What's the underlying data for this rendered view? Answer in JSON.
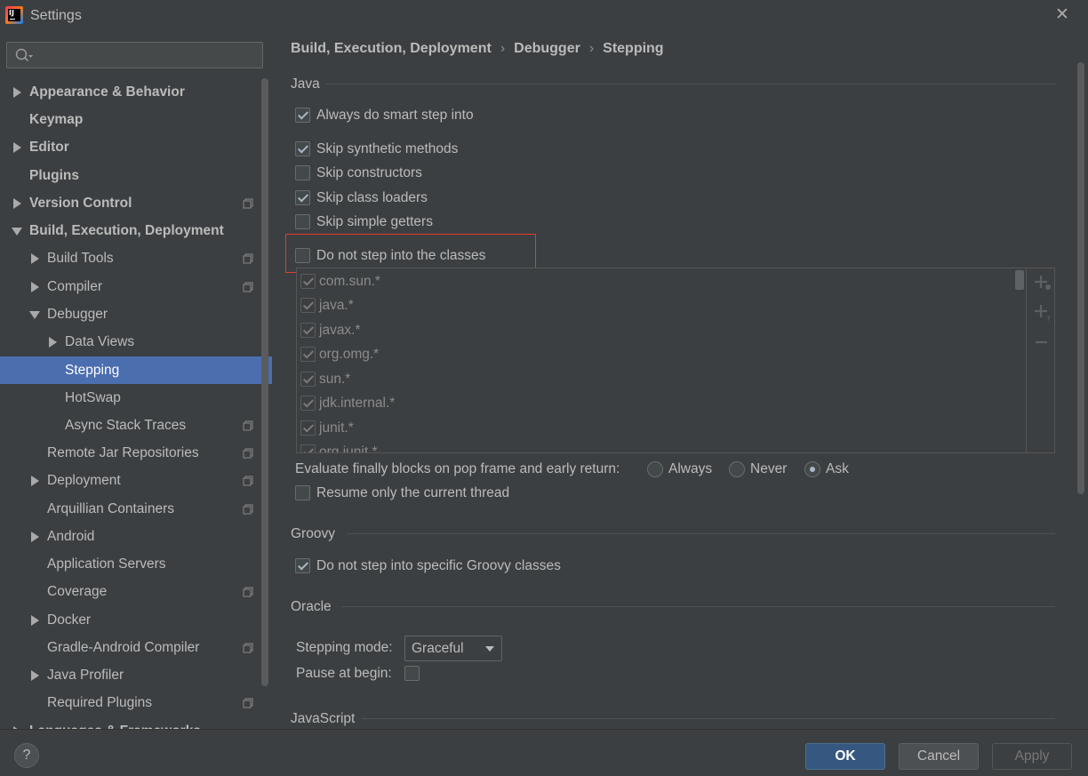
{
  "window": {
    "title": "Settings",
    "app_icon_text": "IJ"
  },
  "search": {
    "placeholder": ""
  },
  "sidebar": {
    "items": [
      {
        "label": "Appearance & Behavior"
      },
      {
        "label": "Keymap"
      },
      {
        "label": "Editor"
      },
      {
        "label": "Plugins"
      },
      {
        "label": "Version Control"
      },
      {
        "label": "Build, Execution, Deployment"
      },
      {
        "label": "Build Tools"
      },
      {
        "label": "Compiler"
      },
      {
        "label": "Debugger"
      },
      {
        "label": "Data Views"
      },
      {
        "label": "Stepping"
      },
      {
        "label": "HotSwap"
      },
      {
        "label": "Async Stack Traces"
      },
      {
        "label": "Remote Jar Repositories"
      },
      {
        "label": "Deployment"
      },
      {
        "label": "Arquillian Containers"
      },
      {
        "label": "Android"
      },
      {
        "label": "Application Servers"
      },
      {
        "label": "Coverage"
      },
      {
        "label": "Docker"
      },
      {
        "label": "Gradle-Android Compiler"
      },
      {
        "label": "Java Profiler"
      },
      {
        "label": "Required Plugins"
      },
      {
        "label": "Languages & Frameworks"
      }
    ]
  },
  "breadcrumb": {
    "part1": "Build, Execution, Deployment",
    "part2": "Debugger",
    "part3": "Stepping",
    "separator": "›"
  },
  "java": {
    "title": "Java",
    "options": {
      "smart_step": {
        "label": "Always do smart step into",
        "checked": true
      },
      "skip_synthetic": {
        "label": "Skip synthetic methods",
        "checked": true
      },
      "skip_constructors": {
        "label": "Skip constructors",
        "checked": false
      },
      "skip_class_loaders": {
        "label": "Skip class loaders",
        "checked": true
      },
      "skip_simple_getters": {
        "label": "Skip simple getters",
        "checked": false
      },
      "do_not_step_classes": {
        "label": "Do not step into the classes",
        "checked": false
      }
    },
    "classes": [
      "com.sun.*",
      "java.*",
      "javax.*",
      "org.omg.*",
      "sun.*",
      "jdk.internal.*",
      "junit.*",
      "org.junit.*"
    ],
    "evaluate_finally": {
      "label": "Evaluate finally blocks on pop frame and early return:",
      "options": [
        "Always",
        "Never",
        "Ask"
      ],
      "selected": "Ask"
    },
    "resume_only_current": {
      "label": "Resume only the current thread",
      "checked": false
    }
  },
  "groovy": {
    "title": "Groovy",
    "do_not_step_groovy": {
      "label": "Do not step into specific Groovy classes",
      "checked": true
    }
  },
  "oracle": {
    "title": "Oracle",
    "stepping_mode_label": "Stepping mode:",
    "stepping_mode_value": "Graceful",
    "pause_at_begin_label": "Pause at begin:",
    "pause_at_begin_checked": false
  },
  "javascript": {
    "title": "JavaScript"
  },
  "footer": {
    "help": "?",
    "ok": "OK",
    "cancel": "Cancel",
    "apply": "Apply"
  },
  "colors": {
    "accent": "#4b6eaf",
    "highlight": "#e03c31",
    "ok": "#365880"
  }
}
